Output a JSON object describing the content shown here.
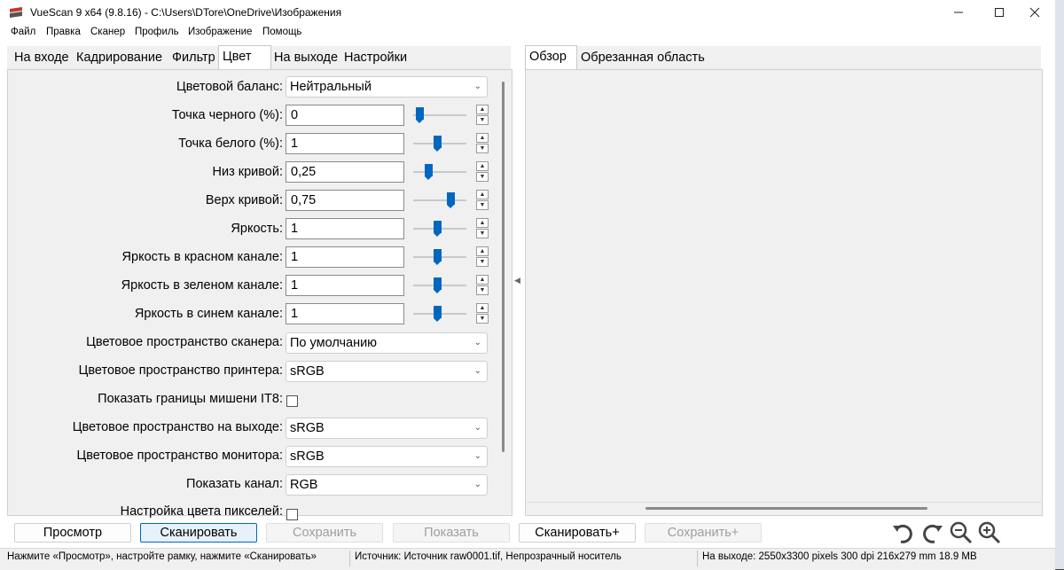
{
  "window": {
    "title": "VueScan 9 x64 (9.8.16) - C:\\Users\\DTore\\OneDrive\\Изображения",
    "minimize_icon": "minimize-icon",
    "maximize_icon": "maximize-icon",
    "close_icon": "close-icon"
  },
  "menu": [
    "Файл",
    "Правка",
    "Сканер",
    "Профиль",
    "Изображение",
    "Помощь"
  ],
  "left_tabs": [
    {
      "label": "На входе",
      "active": false
    },
    {
      "label": "Кадрирование",
      "active": false
    },
    {
      "label": "Фильтр",
      "active": false
    },
    {
      "label": "Цвет",
      "active": true
    },
    {
      "label": "На выходе",
      "active": false
    },
    {
      "label": "Настройки",
      "active": false
    }
  ],
  "right_tabs": [
    {
      "label": "Обзор",
      "active": true
    },
    {
      "label": "Обрезанная область",
      "active": false
    }
  ],
  "color_settings": {
    "color_balance": {
      "label": "Цветовой баланс:",
      "value": "Нейтральный"
    },
    "sliders": [
      {
        "label": "Точка черного (%):",
        "value": "0",
        "position": 0.05
      },
      {
        "label": "Точка белого (%):",
        "value": "1",
        "position": 0.45
      },
      {
        "label": "Низ кривой:",
        "value": "0,25",
        "position": 0.25
      },
      {
        "label": "Верх кривой:",
        "value": "0,75",
        "position": 0.75
      },
      {
        "label": "Яркость:",
        "value": "1",
        "position": 0.45
      },
      {
        "label": "Яркость в красном канале:",
        "value": "1",
        "position": 0.45
      },
      {
        "label": "Яркость в зеленом канале:",
        "value": "1",
        "position": 0.45
      },
      {
        "label": "Яркость в синем канале:",
        "value": "1",
        "position": 0.45
      }
    ],
    "scanner_space": {
      "label": "Цветовое пространство сканера:",
      "value": "По умолчанию"
    },
    "printer_space": {
      "label": "Цветовое пространство принтера:",
      "value": "sRGB"
    },
    "it8": {
      "label": "Показать границы мишени IT8:",
      "checked": false
    },
    "output_space": {
      "label": "Цветовое пространство на выходе:",
      "value": "sRGB"
    },
    "monitor_space": {
      "label": "Цветовое пространство монитора:",
      "value": "sRGB"
    },
    "show_channel": {
      "label": "Показать канал:",
      "value": "RGB"
    },
    "pixel_color": {
      "label": "Настройка цвета пикселей:",
      "checked": false
    }
  },
  "buttons": {
    "preview": "Просмотр",
    "scan": "Сканировать",
    "save": "Сохранить",
    "show": "Показать",
    "scan_plus": "Сканировать+",
    "save_plus": "Сохранить+"
  },
  "toolbar_icons": [
    "rotate-left-icon",
    "rotate-right-icon",
    "zoom-out-icon",
    "zoom-in-icon"
  ],
  "status": {
    "hint": "Нажмите «Просмотр», настройте рамку, нажмите «Сканировать»",
    "source": "Источник: Источник raw0001.tif, Непрозрачный носитель",
    "output": "На выходе: 2550x3300 pixels 300 dpi 216x279 mm 18.9 MB"
  },
  "colors": {
    "accent": "#0067c0",
    "panel": "#f0f0f0"
  }
}
